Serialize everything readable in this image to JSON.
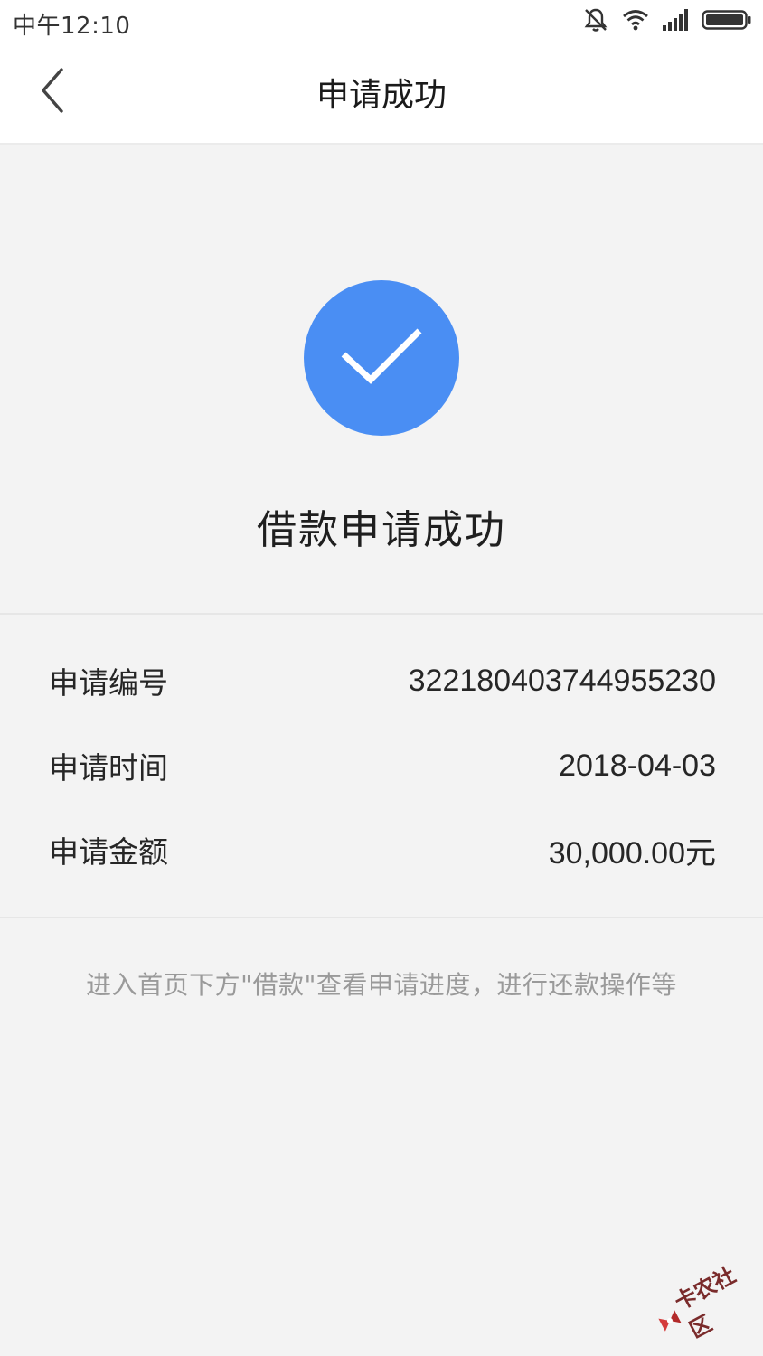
{
  "status_bar": {
    "time": "中午12:10",
    "icons": [
      "mute-icon",
      "wifi-icon",
      "signal-icon",
      "battery-icon"
    ]
  },
  "nav": {
    "back_icon": "chevron-left-icon",
    "title": "申请成功"
  },
  "result": {
    "icon": "check-circle-icon",
    "icon_color": "#4a8ef3",
    "title": "借款申请成功"
  },
  "details": [
    {
      "label": "申请编号",
      "value": "322180403744955230"
    },
    {
      "label": "申请时间",
      "value": "2018-04-03"
    },
    {
      "label": "申请金额",
      "value": "30,000.00元"
    }
  ],
  "hint": "进入首页下方\"借款\"查看申请进度，进行还款操作等",
  "watermark": "卡农社区",
  "colors": {
    "background": "#f3f3f3",
    "header": "#ffffff",
    "accent": "#4a8ef3",
    "hint_text": "#9a9a9a"
  }
}
